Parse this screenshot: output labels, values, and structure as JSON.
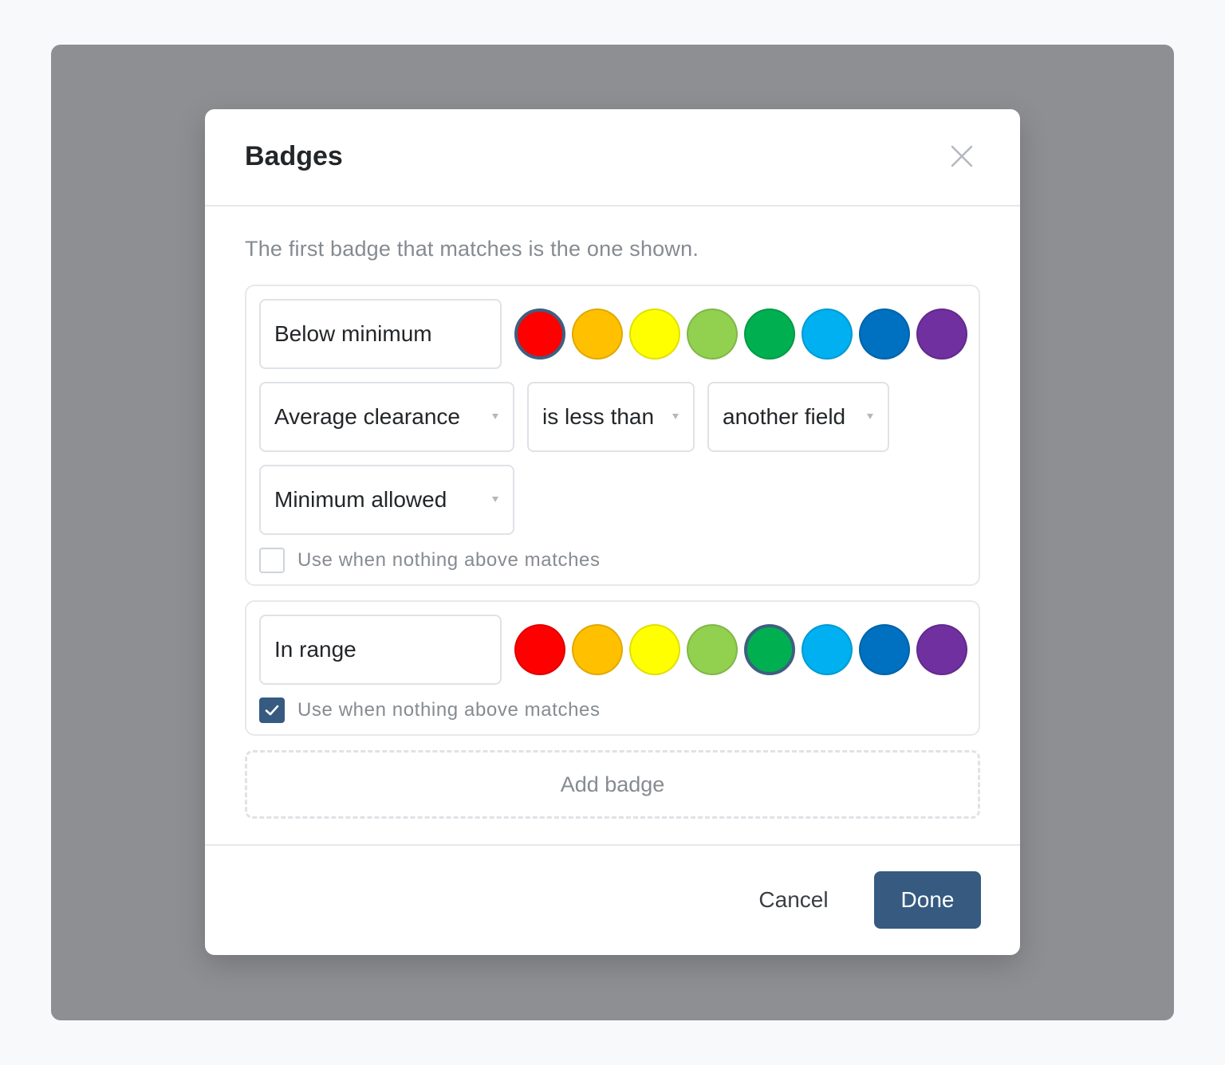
{
  "dialog": {
    "title": "Badges",
    "close_icon": "close-icon",
    "hint": "The first badge that matches is the one shown."
  },
  "palette": [
    "#ff0000",
    "#ffc000",
    "#ffff00",
    "#92d050",
    "#00b050",
    "#00b0f0",
    "#0070c0",
    "#7030a0"
  ],
  "badges": [
    {
      "name": "Below minimum",
      "selected_color": "#ff0000",
      "conditions": {
        "field": "Average clearance",
        "operator": "is less than",
        "compare_to": "another field",
        "other_field": "Minimum allowed"
      },
      "fallback_label": "Use when nothing above matches",
      "fallback_checked": false
    },
    {
      "name": "In range",
      "selected_color": "#00b050",
      "fallback_label": "Use when nothing above matches",
      "fallback_checked": true
    }
  ],
  "add_badge_label": "Add badge",
  "footer": {
    "cancel_label": "Cancel",
    "done_label": "Done"
  },
  "colors": {
    "accent": "#365a80",
    "selected_ring": "#3e5f80"
  }
}
